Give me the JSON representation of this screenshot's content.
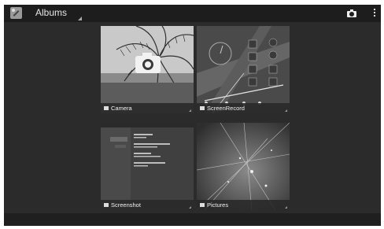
{
  "actionbar": {
    "title": "Albums",
    "app_icon": "gallery-icon",
    "camera_icon": "camera-icon",
    "overflow_icon": "overflow-menu-icon"
  },
  "albums": [
    {
      "label": "Camera",
      "icon": "camera-small-icon"
    },
    {
      "label": "ScreenRecord",
      "icon": "folder-icon"
    },
    {
      "label": "Screenshot",
      "icon": "folder-icon"
    },
    {
      "label": "Pictures",
      "icon": "folder-icon"
    }
  ],
  "colors": {
    "actionbar": "#1d1d1d",
    "background": "#2b2b2b",
    "caption": "#282828"
  }
}
